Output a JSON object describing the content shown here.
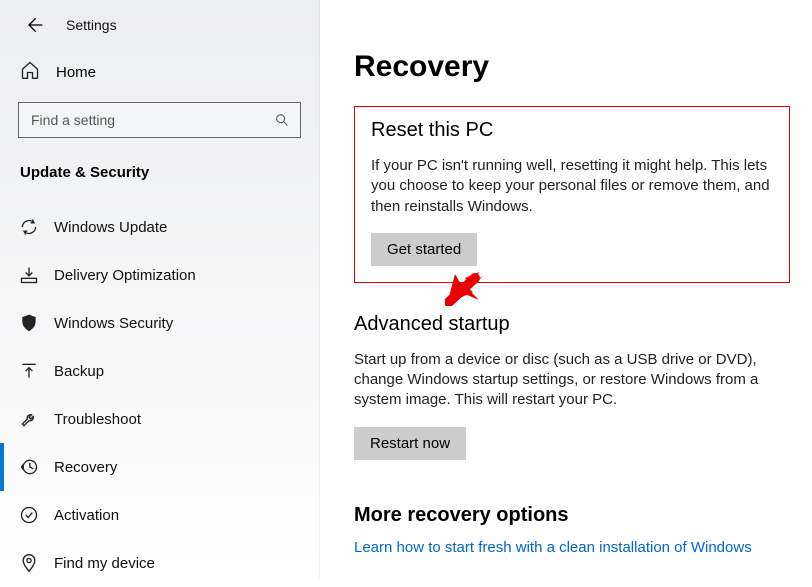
{
  "app_title": "Settings",
  "home_label": "Home",
  "search": {
    "placeholder": "Find a setting"
  },
  "section_head": "Update & Security",
  "nav": {
    "items": [
      {
        "name": "windows-update",
        "label": "Windows Update"
      },
      {
        "name": "delivery-optimization",
        "label": "Delivery Optimization"
      },
      {
        "name": "windows-security",
        "label": "Windows Security"
      },
      {
        "name": "backup",
        "label": "Backup"
      },
      {
        "name": "troubleshoot",
        "label": "Troubleshoot"
      },
      {
        "name": "recovery",
        "label": "Recovery"
      },
      {
        "name": "activation",
        "label": "Activation"
      },
      {
        "name": "find-my-device",
        "label": "Find my device"
      }
    ],
    "selected_index": 5
  },
  "page": {
    "title": "Recovery",
    "reset": {
      "heading": "Reset this PC",
      "body": "If your PC isn't running well, resetting it might help. This lets you choose to keep your personal files or remove them, and then reinstalls Windows.",
      "button": "Get started"
    },
    "advanced": {
      "heading": "Advanced startup",
      "body": "Start up from a device or disc (such as a USB drive or DVD), change Windows startup settings, or restore Windows from a system image. This will restart your PC.",
      "button": "Restart now"
    },
    "more": {
      "heading": "More recovery options",
      "link": "Learn how to start fresh with a clean installation of Windows"
    }
  },
  "annotation": {
    "highlight_color": "#e80000"
  }
}
